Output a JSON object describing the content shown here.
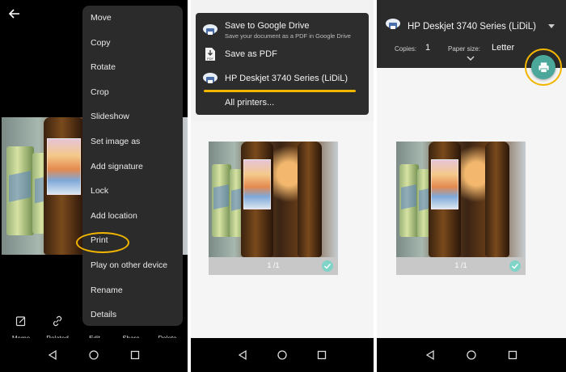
{
  "screen1": {
    "menu_items": [
      "Move",
      "Copy",
      "Rotate",
      "Crop",
      "Slideshow",
      "Set image as",
      "Add signature",
      "Lock",
      "Add location",
      "Print",
      "Play on other device",
      "Rename",
      "Details"
    ],
    "bottom_actions": [
      {
        "label": "Memo",
        "icon": "memo-icon"
      },
      {
        "label": "Related",
        "icon": "link-icon"
      },
      {
        "label": "Edit",
        "icon": "edit-icon"
      },
      {
        "label": "Share",
        "icon": "share-icon"
      },
      {
        "label": "Delete",
        "icon": "delete-icon"
      }
    ]
  },
  "screen2": {
    "destinations": [
      {
        "title": "Save to Google Drive",
        "subtitle": "Save your document as a PDF in Google Drive",
        "icon": "cloud-printer-icon"
      },
      {
        "title": "Save as PDF",
        "subtitle": "",
        "icon": "pdf-icon"
      },
      {
        "title": "HP Deskjet 3740 Series (LiDiL)",
        "subtitle": "",
        "icon": "printer-icon"
      },
      {
        "title": "All printers...",
        "subtitle": "",
        "icon": ""
      }
    ],
    "page_count": "1 /1"
  },
  "screen3": {
    "printer_name": "HP Deskjet 3740 Series (LiDiL)",
    "copies_label": "Copies:",
    "copies_value": "1",
    "paper_size_label": "Paper size:",
    "paper_size_value": "Letter",
    "page_count": "1 /1"
  },
  "colors": {
    "highlight": "#f2b600",
    "fab": "#4aa79a",
    "menu_bg": "#2b2b2b",
    "check": "#7fd3c7"
  }
}
